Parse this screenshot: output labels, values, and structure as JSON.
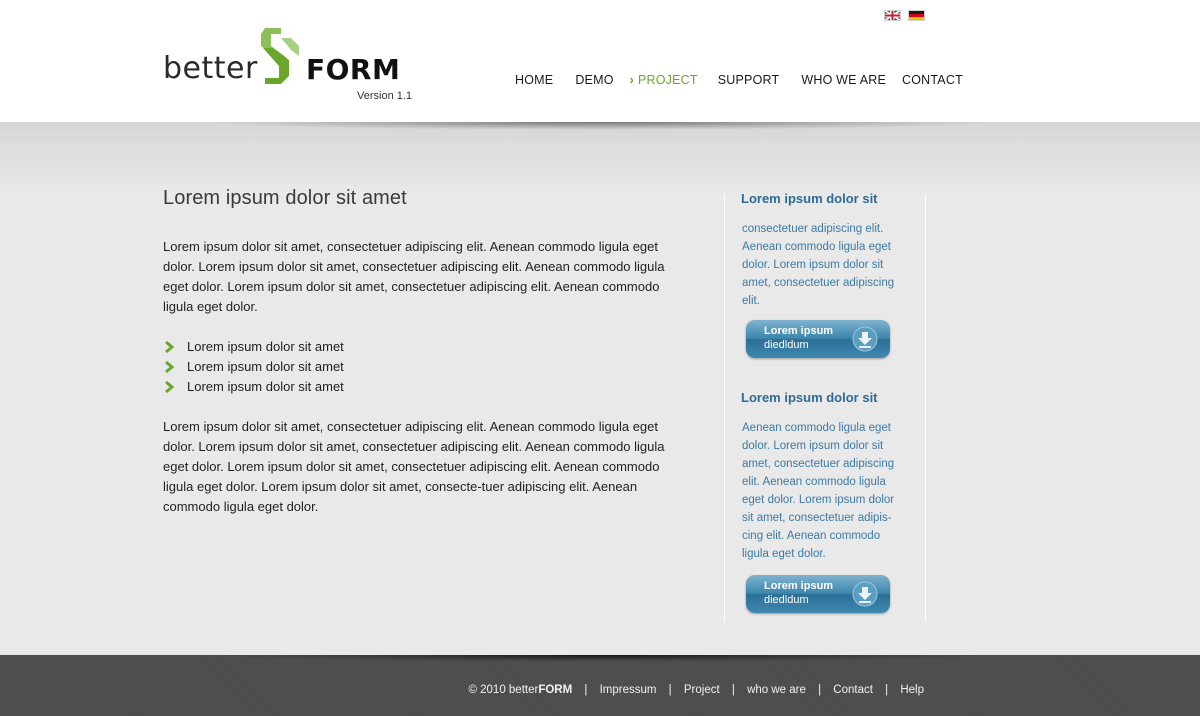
{
  "header": {
    "flags": [
      "english-flag",
      "german-flag"
    ],
    "logo": {
      "better": "better",
      "form": "FORM",
      "version": "Version 1.1"
    },
    "nav": [
      {
        "label": "HOME"
      },
      {
        "label": "DEMO"
      },
      {
        "label": "PROJECT",
        "active": true
      },
      {
        "label": "SUPPORT"
      },
      {
        "label": "WHO WE ARE"
      },
      {
        "label": "CONTACT"
      }
    ]
  },
  "main": {
    "title": "Lorem ipsum dolor sit amet",
    "paragraph1": "Lorem ipsum dolor sit amet, consectetuer adipiscing elit. Aenean commodo ligula eget dolor. Lorem ipsum dolor sit amet, consectetuer adipiscing elit. Aenean commodo ligula eget dolor. Lorem ipsum dolor sit amet, consectetuer adipiscing elit. Aenean commodo ligula eget dolor.",
    "bullets": [
      "Lorem ipsum dolor sit amet",
      "Lorem ipsum dolor sit amet",
      "Lorem ipsum dolor sit amet"
    ],
    "paragraph2": "Lorem ipsum dolor sit amet, consectetuer adipiscing elit. Aenean commodo ligula eget dolor. Lorem ipsum dolor sit amet, consectetuer adipiscing elit. Aenean commodo ligula eget dolor. Lorem ipsum dolor sit amet, consectetuer adipiscing elit. Aenean commodo ligula eget dolor. Lorem ipsum dolor sit amet, consecte-tuer adipiscing elit. Aenean commodo ligula eget dolor."
  },
  "sidebar": {
    "blocks": [
      {
        "title": "Lorem ipsum dolor sit",
        "text": "consectetuer adipiscing elit. Aenean commodo ligula eget dolor. Lorem ipsum dolor sit amet, consectetuer adipiscing elit.",
        "button_line1": "Lorem ipsum",
        "button_line2": "diedldum"
      },
      {
        "title": "Lorem ipsum dolor sit",
        "text": "Aenean commodo ligula eget dolor. Lorem ipsum dolor sit amet, consectetuer adipiscing elit. Aenean commodo ligula eget dolor. Lorem ipsum dolor sit amet, consectetuer adipis-cing elit. Aenean commodo ligula eget dolor.",
        "button_line1": "Lorem ipsum",
        "button_line2": "diedldum"
      }
    ]
  },
  "footer": {
    "copyright": "© 2010 better",
    "copyright_brand": "FORM",
    "links": [
      "Impressum",
      "Project",
      "who we are",
      "Contact",
      "Help"
    ]
  },
  "colors": {
    "accent_green": "#6aa52c",
    "sidebar_blue": "#2e6a96",
    "footer_bg": "#4c4c4c"
  }
}
